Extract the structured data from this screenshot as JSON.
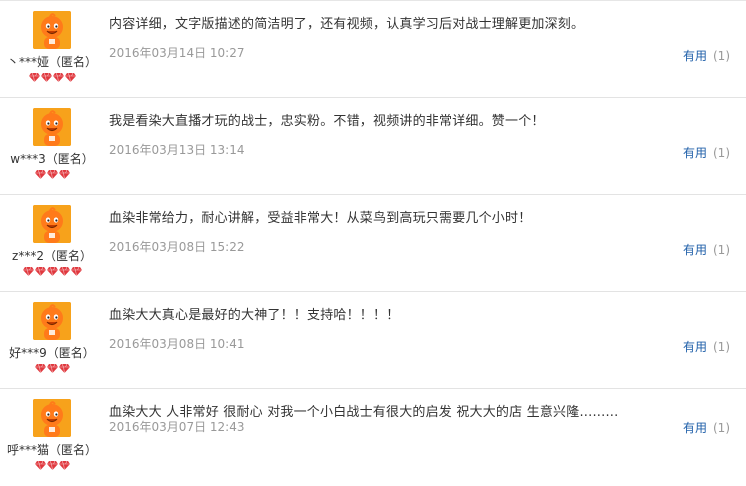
{
  "reviews": [
    {
      "username": "丶***娅（匿名）",
      "level": 4,
      "content": "内容详细，文字版描述的简洁明了，还有视频，认真学习后对战士理解更加深刻。",
      "date": "2016年03月14日 10:27",
      "helpful_label": "有用",
      "helpful_count": "(1)"
    },
    {
      "username": "w***3（匿名）",
      "level": 3,
      "content": "我是看染大直播才玩的战士，忠实粉。不错，视频讲的非常详细。赞一个！",
      "date": "2016年03月13日 13:14",
      "helpful_label": "有用",
      "helpful_count": "(1)"
    },
    {
      "username": "z***2（匿名）",
      "level": 5,
      "content": "血染非常给力，耐心讲解，受益非常大！从菜鸟到高玩只需要几个小时！",
      "date": "2016年03月08日 15:22",
      "helpful_label": "有用",
      "helpful_count": "(1)"
    },
    {
      "username": "好***9（匿名）",
      "level": 3,
      "content": "血染大大真心是最好的大神了！！支持哈！！！！",
      "date": "2016年03月08日 10:41",
      "helpful_label": "有用",
      "helpful_count": "(1)"
    },
    {
      "username": "呼***猫（匿名）",
      "level": 3,
      "content": "血染大大 人非常好 很耐心 对我一个小白战士有很大的启发 祝大大的店 生意兴隆.........",
      "date": "2016年03月07日 12:43",
      "helpful_label": "有用",
      "helpful_count": "(1)"
    }
  ],
  "colors": {
    "avatar": "#f7a21b",
    "badge": "#e0383e",
    "link": "#1f5fa9",
    "muted": "#999999"
  },
  "icons": {
    "avatar": "orange-mascot-avatar-icon",
    "badge": "red-diamond-icon"
  }
}
